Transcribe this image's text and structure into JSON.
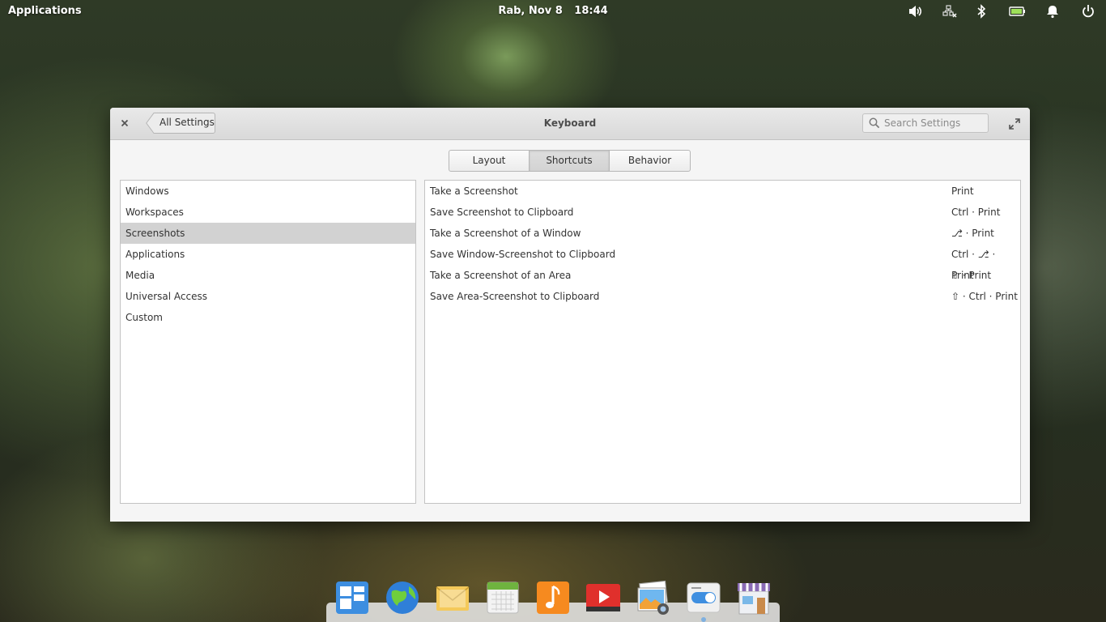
{
  "panel": {
    "applications_label": "Applications",
    "date": "Rab, Nov 8",
    "time": "18:44",
    "tray_icons": [
      "volume-icon",
      "network-icon",
      "bluetooth-icon",
      "battery-icon",
      "notifications-icon",
      "power-icon"
    ]
  },
  "window": {
    "title": "Keyboard",
    "back_label": "All Settings",
    "search_placeholder": "Search Settings",
    "tabs": [
      {
        "label": "Layout"
      },
      {
        "label": "Shortcuts"
      },
      {
        "label": "Behavior"
      }
    ],
    "active_tab": "Shortcuts",
    "categories": [
      {
        "label": "Windows"
      },
      {
        "label": "Workspaces"
      },
      {
        "label": "Screenshots"
      },
      {
        "label": "Applications"
      },
      {
        "label": "Media"
      },
      {
        "label": "Universal Access"
      },
      {
        "label": "Custom"
      }
    ],
    "selected_category": "Screenshots",
    "shortcuts": [
      {
        "name": "Take a Screenshot",
        "keys": "Print"
      },
      {
        "name": "Save Screenshot to Clipboard",
        "keys": "Ctrl · Print"
      },
      {
        "name": "Take a Screenshot of a Window",
        "keys": "⎇ · Print"
      },
      {
        "name": "Save Window-Screenshot to Clipboard",
        "keys": "Ctrl · ⎇ · Print"
      },
      {
        "name": "Take a Screenshot of an Area",
        "keys": "⇧ · Print"
      },
      {
        "name": "Save Area-Screenshot to Clipboard",
        "keys": "⇧ · Ctrl · Print"
      }
    ]
  },
  "dock": {
    "apps": [
      "multitasking-view-icon",
      "web-browser-icon",
      "mail-icon",
      "calendar-icon",
      "music-icon",
      "videos-icon",
      "photos-icon",
      "system-settings-icon",
      "appcenter-icon"
    ],
    "running_indicator": "system-settings-icon"
  }
}
